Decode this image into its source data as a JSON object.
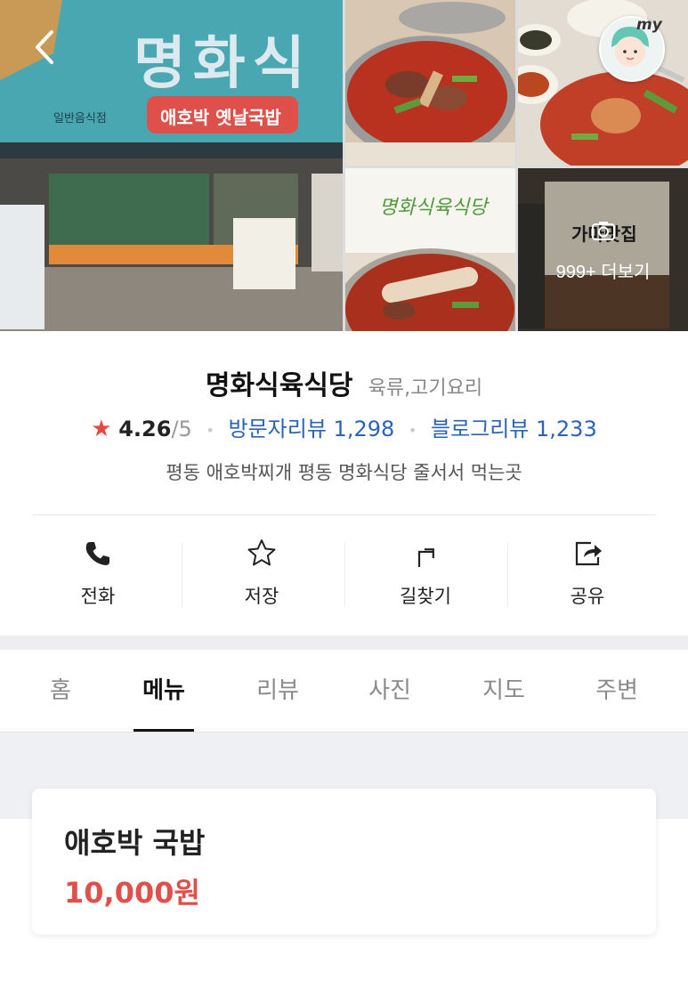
{
  "gallery": {
    "more_label": "999+ 더보기",
    "my_label": "my",
    "sign_text": "명화식",
    "sign_sub": "애호박 옛날국밥",
    "sign_small": "일반음식점",
    "script_text": "명화식육식당",
    "poster_text": "가마맛집",
    "icons": [
      "back-arrow-icon",
      "camera-icon"
    ]
  },
  "place": {
    "name": "명화식육식당",
    "category": "육류,고기요리",
    "rating_star": "★",
    "rating": "4.26",
    "rating_max": "/5",
    "visitor_reviews": "방문자리뷰 1,298",
    "blog_reviews": "블로그리뷰 1,233",
    "description": "평동 애호박찌개 평동 명화식당 줄서서 먹는곳"
  },
  "actions": [
    {
      "label": "전화",
      "icon": "phone-icon"
    },
    {
      "label": "저장",
      "icon": "star-icon"
    },
    {
      "label": "길찾기",
      "icon": "directions-icon"
    },
    {
      "label": "공유",
      "icon": "share-icon"
    }
  ],
  "tabs": [
    {
      "label": "홈"
    },
    {
      "label": "메뉴",
      "active": true
    },
    {
      "label": "리뷰"
    },
    {
      "label": "사진"
    },
    {
      "label": "지도"
    },
    {
      "label": "주변"
    }
  ],
  "menu": [
    {
      "name": "애호박 국밥",
      "price": "10,000원"
    }
  ],
  "colors": {
    "accent_red": "#e0504b",
    "link_blue": "#2a63b8",
    "star_red": "#e8473f"
  }
}
